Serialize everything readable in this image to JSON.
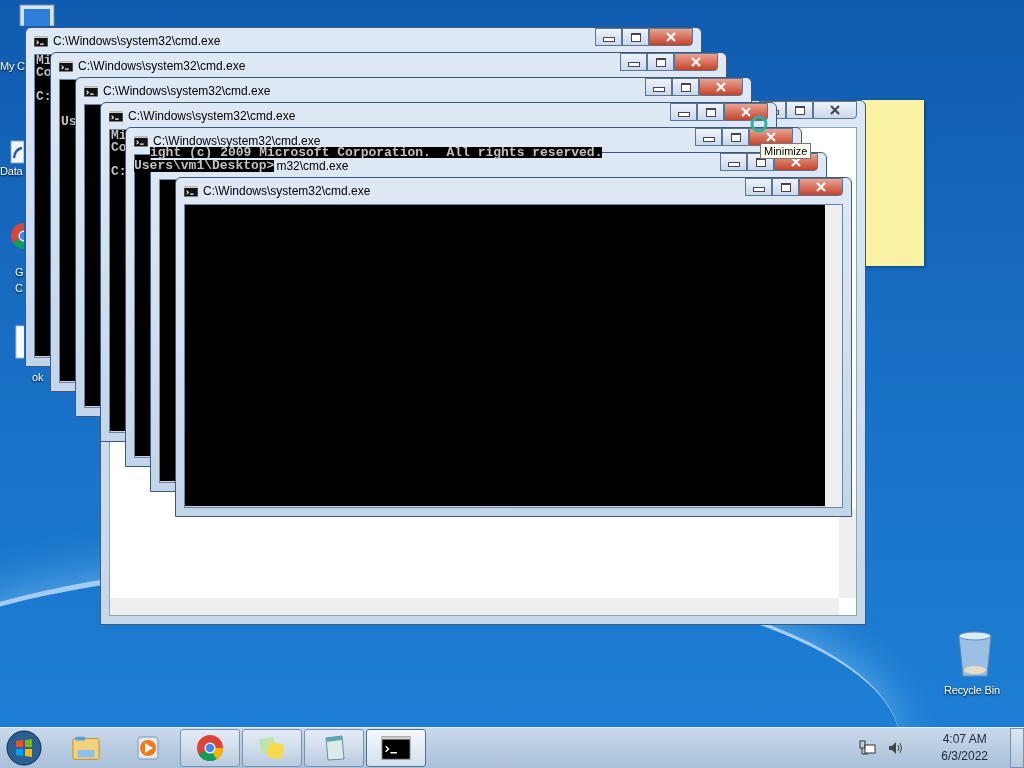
{
  "desktop_icons": [
    {
      "kind": "computer",
      "label_lines": [
        "My C"
      ]
    },
    {
      "kind": "shortcut",
      "label_lines": [
        "Data"
      ]
    },
    {
      "kind": "browser",
      "label_lines": [
        "G",
        "C"
      ]
    },
    {
      "kind": "document",
      "label_lines": [
        "ok"
      ]
    },
    {
      "kind": "recycle",
      "label_lines": [
        "Recycle Bin"
      ]
    }
  ],
  "windows": [
    {
      "title": "C:\\Windows\\system32\\cmd.exe",
      "lines": [
        "Mi",
        "Co"
      ],
      "prompt": "C:"
    },
    {
      "title": "C:\\Windows\\system32\\cmd.exe",
      "prompt": "Us"
    },
    {
      "title": "C:\\Windows\\system32\\cmd.exe"
    },
    {
      "title": "C:\\Windows\\system32\\cmd.exe",
      "lines": [
        "Mi",
        "Co"
      ],
      "prompt": "C:"
    },
    {
      "title": "C:\\Windows\\system32\\cmd.exe"
    },
    {
      "title": "m32\\cmd.exe",
      "overlay_text": "Users\\vm1\\Desktop>"
    },
    {
      "title": "C:\\Windows\\system32\\cmd.exe"
    }
  ],
  "console_overlay": [
    "ight (c) 2009 Microsoft Corporation.  All rights reserved."
  ],
  "tooltip": {
    "text": "Minimize"
  },
  "taskbar": {
    "items": [
      {
        "kind": "explorer",
        "running": false,
        "selected": false
      },
      {
        "kind": "media",
        "running": false,
        "selected": false
      },
      {
        "kind": "browser",
        "running": true,
        "selected": false
      },
      {
        "kind": "notes",
        "running": true,
        "selected": false
      },
      {
        "kind": "notepad",
        "running": true,
        "selected": false
      },
      {
        "kind": "console",
        "running": true,
        "selected": true
      }
    ],
    "clock": {
      "time": "4:07 AM",
      "date": "6/3/2022"
    }
  }
}
